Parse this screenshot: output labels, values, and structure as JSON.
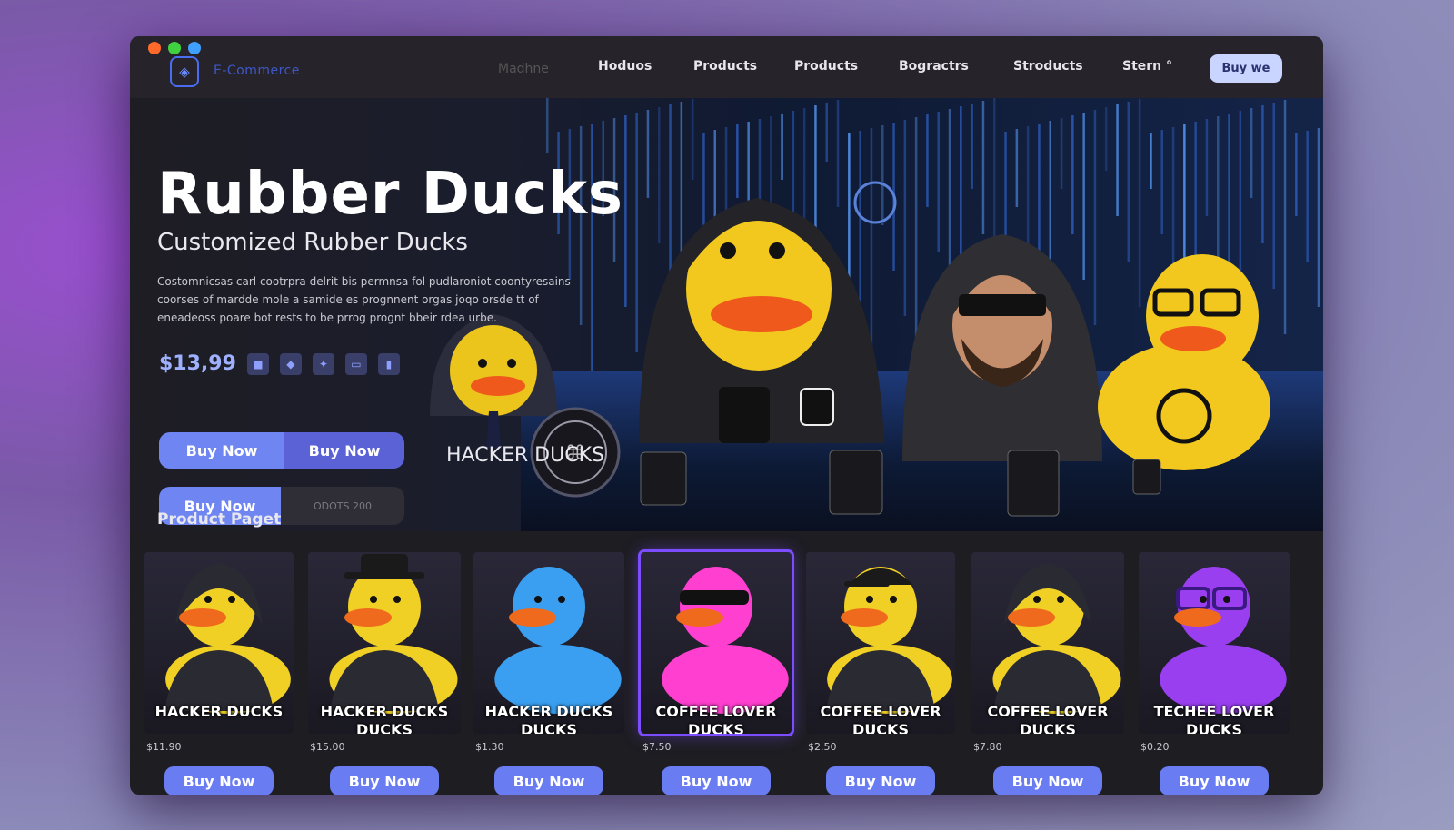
{
  "window": {
    "traffic_colors": [
      "#ff6a2a",
      "#3fd13f",
      "#3fa0ff"
    ]
  },
  "navbar": {
    "brand": "E-Commerce",
    "ghost_item": "Madhne",
    "links": [
      "Hoduos",
      "Products",
      "Products",
      "Bogractrs",
      "Stroducts",
      "Stern °"
    ],
    "buy_label": "Buy we"
  },
  "hero": {
    "title": "Rubber Ducks",
    "subtitle": "Customized Rubber Ducks",
    "description": "Costomnicsas carl cootrpra delrit bis permnsa fol pudlaroniot coontyresains coorses of mardde mole a samide es prognnent orgas joqo orsde tt of eneadeoss poare bot rests to be prrog prognt bbeir rdea urbe.",
    "price": "$13,99",
    "swatch_icons": [
      "square-icon",
      "shape-icon",
      "spark-icon",
      "screen-icon",
      "bar-icon"
    ],
    "buy_now_1": "Buy Now",
    "buy_now_2": "Buy Now",
    "buy_now_3": "Buy Now",
    "secondary_text": "ODOTS 200",
    "table_sign": "HACKER DUCKS"
  },
  "section_title": "Product Paget",
  "products": [
    {
      "name": "HACKER DUCKS",
      "price": "$11.90",
      "buy_label": "Buy Now",
      "body_color": "#f0d024",
      "accent": "#2a2a32",
      "hat": "hood"
    },
    {
      "name": "HACKER DUCKS DUCKS",
      "price": "$15.00",
      "buy_label": "Buy Now",
      "body_color": "#f0d024",
      "accent": "#2a2a32",
      "hat": "fedora"
    },
    {
      "name": "HACKER DUCKS DUCKS",
      "price": "$1.30",
      "buy_label": "Buy Now",
      "body_color": "#3a9ff0",
      "accent": "#2060b0",
      "hat": "none"
    },
    {
      "name": "COFFEE LOVER DUCKS",
      "price": "$7.50",
      "buy_label": "Buy Now",
      "body_color": "#ff3fd0",
      "accent": "#111111",
      "hat": "shades",
      "active": true
    },
    {
      "name": "COFFEE LOVER DUCKS",
      "price": "$2.50",
      "buy_label": "Buy Now",
      "body_color": "#f0d024",
      "accent": "#2a2a32",
      "hat": "cap"
    },
    {
      "name": "COFFEE LOVER DUCKS",
      "price": "$7.80",
      "buy_label": "Buy Now",
      "body_color": "#f0d024",
      "accent": "#2a2a32",
      "hat": "hood"
    },
    {
      "name": "TECHEE LOVER DUCKS",
      "price": "$0.20",
      "buy_label": "Buy Now",
      "body_color": "#9a3ff0",
      "accent": "#5a1fb0",
      "hat": "glasses"
    }
  ]
}
